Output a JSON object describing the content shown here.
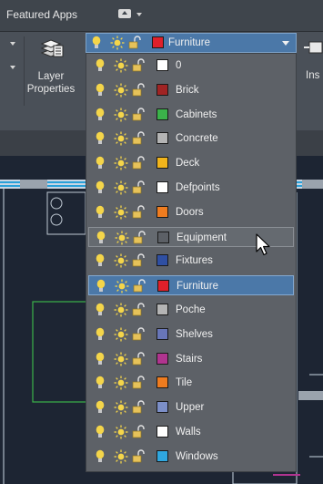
{
  "topbar": {
    "tab_title": "Featured Apps"
  },
  "ribbon": {
    "layer_properties_label": "Layer\nProperties",
    "insert_label_partial": "Ins"
  },
  "layer_combo": {
    "current_layer": "Furniture",
    "current_color": "#e0202a"
  },
  "colors": {
    "bulb_on": "#f4d54a",
    "sun": "#f4d54a",
    "lock_open": "#e6c25a",
    "selection": "#4b78a8"
  },
  "layers": [
    {
      "name": "0",
      "color": "#ffffff"
    },
    {
      "name": "Brick",
      "color": "#a02424"
    },
    {
      "name": "Cabinets",
      "color": "#3bb34a"
    },
    {
      "name": "Concrete",
      "color": "#b4b4b4"
    },
    {
      "name": "Deck",
      "color": "#f2b51b"
    },
    {
      "name": "Defpoints",
      "color": "#ffffff"
    },
    {
      "name": "Doors",
      "color": "#ef7c1f"
    },
    {
      "name": "Equipment",
      "color": "#5c6066",
      "state": "hover"
    },
    {
      "name": "Fixtures",
      "color": "#2f4fa2"
    },
    {
      "name": "Furniture",
      "color": "#e0202a",
      "state": "selected"
    },
    {
      "name": "Poche",
      "color": "#b4b4b4"
    },
    {
      "name": "Shelves",
      "color": "#6876b8"
    },
    {
      "name": "Stairs",
      "color": "#b0348f"
    },
    {
      "name": "Tile",
      "color": "#ef7c1f"
    },
    {
      "name": "Upper",
      "color": "#7c8fc8"
    },
    {
      "name": "Walls",
      "color": "#ffffff"
    },
    {
      "name": "Windows",
      "color": "#2fa7df"
    }
  ]
}
